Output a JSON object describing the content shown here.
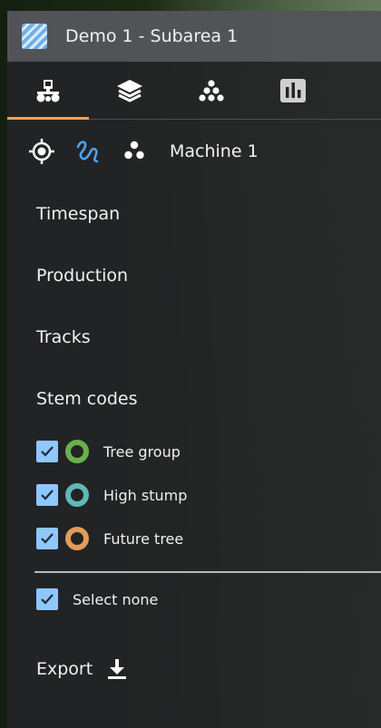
{
  "header": {
    "title": "Demo 1 - Subarea 1",
    "icon": "area-hatch-icon"
  },
  "tabs": [
    {
      "icon": "machine-icon",
      "active": true
    },
    {
      "icon": "layers-icon",
      "active": false
    },
    {
      "icon": "stems-pile-icon",
      "active": false
    },
    {
      "icon": "stats-icon",
      "active": false
    }
  ],
  "machine": {
    "name": "Machine 1"
  },
  "sections": {
    "timespan": "Timespan",
    "production": "Production",
    "tracks": "Tracks",
    "stem_codes": "Stem codes"
  },
  "stem_codes": [
    {
      "label": "Tree group",
      "checked": true,
      "color": "#6ab04c"
    },
    {
      "label": "High stump",
      "checked": true,
      "color": "#5fb7b8"
    },
    {
      "label": "Future tree",
      "checked": true,
      "color": "#e39a5a"
    }
  ],
  "select_none": {
    "label": "Select none",
    "checked": true
  },
  "export": {
    "label": "Export"
  },
  "colors": {
    "accent": "#e8a35a",
    "checkbox": "#8fc7ff",
    "tool_active": "#4da3f0"
  }
}
